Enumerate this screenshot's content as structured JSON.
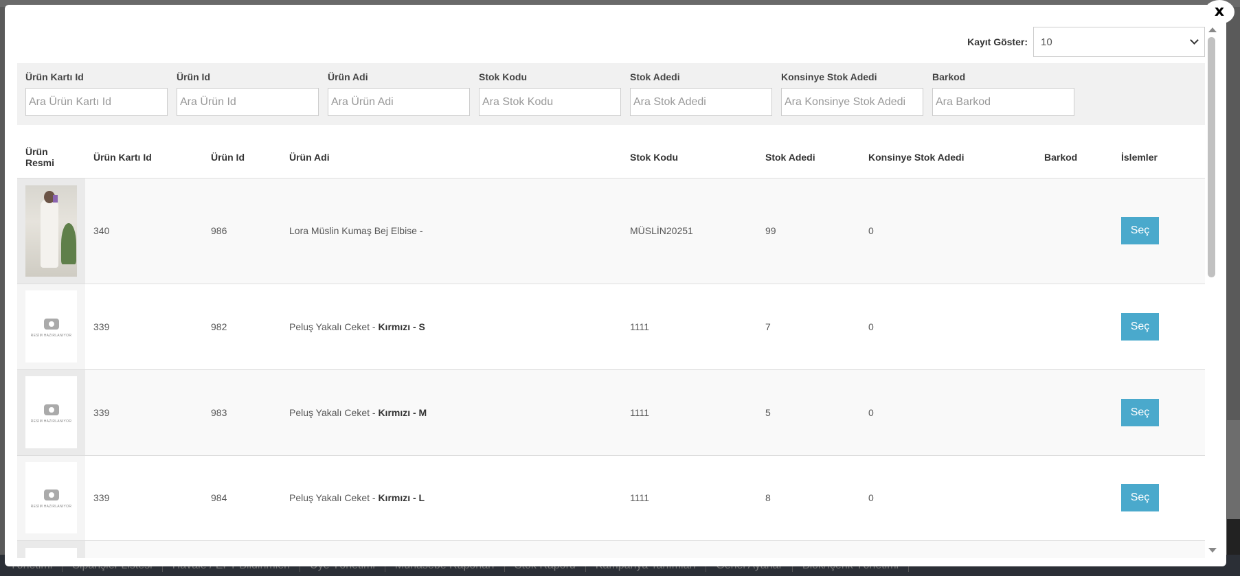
{
  "background_nav": [
    "Yönetimi",
    "Siparişler Listesi",
    "Havale / EFT Bildirimleri",
    "Üye Yönetimi",
    "Muhasebe Raporları",
    "Stok Raporu",
    "Kampanya Tanımları",
    "Genel Ayarlar",
    "Blok/İçerik Yönetimi"
  ],
  "modal": {
    "close_label": "x",
    "length": {
      "label": "Kayıt Göster:",
      "value": "10"
    },
    "filters": [
      {
        "label": "Ürün Kartı Id",
        "placeholder": "Ara Ürün Kartı Id"
      },
      {
        "label": "Ürün Id",
        "placeholder": "Ara Ürün Id"
      },
      {
        "label": "Ürün Adi",
        "placeholder": "Ara Ürün Adi"
      },
      {
        "label": "Stok Kodu",
        "placeholder": "Ara Stok Kodu"
      },
      {
        "label": "Stok Adedi",
        "placeholder": "Ara Stok Adedi"
      },
      {
        "label": "Konsinye Stok Adedi",
        "placeholder": "Ara Konsinye Stok Adedi"
      },
      {
        "label": "Barkod",
        "placeholder": "Ara Barkod"
      }
    ],
    "columns": [
      "Ürün Resmi",
      "Ürün Kartı Id",
      "Ürün Id",
      "Ürün Adi",
      "Stok Kodu",
      "Stok Adedi",
      "Konsinye Stok Adedi",
      "Barkod",
      "İslemler"
    ],
    "placeholder_image_text": "RESİM HAZIRLANIYOR",
    "rows": [
      {
        "image": "photo",
        "kart_id": "340",
        "urun_id": "986",
        "name": "Lora Müslin Kumaş Bej Elbise -",
        "variant": "",
        "stok_kodu": "MÜSLİN20251",
        "stok_adedi": "99",
        "konsinye": "0",
        "barkod": "",
        "action": "Seç"
      },
      {
        "image": "placeholder",
        "kart_id": "339",
        "urun_id": "982",
        "name": "Peluş Yakalı Ceket -",
        "variant": "Kırmızı - S",
        "stok_kodu": "1111",
        "stok_adedi": "7",
        "konsinye": "0",
        "barkod": "",
        "action": "Seç"
      },
      {
        "image": "placeholder",
        "kart_id": "339",
        "urun_id": "983",
        "name": "Peluş Yakalı Ceket -",
        "variant": "Kırmızı - M",
        "stok_kodu": "1111",
        "stok_adedi": "5",
        "konsinye": "0",
        "barkod": "",
        "action": "Seç"
      },
      {
        "image": "placeholder",
        "kart_id": "339",
        "urun_id": "984",
        "name": "Peluş Yakalı Ceket -",
        "variant": "Kırmızı - L",
        "stok_kodu": "1111",
        "stok_adedi": "8",
        "konsinye": "0",
        "barkod": "",
        "action": "Seç"
      }
    ]
  }
}
